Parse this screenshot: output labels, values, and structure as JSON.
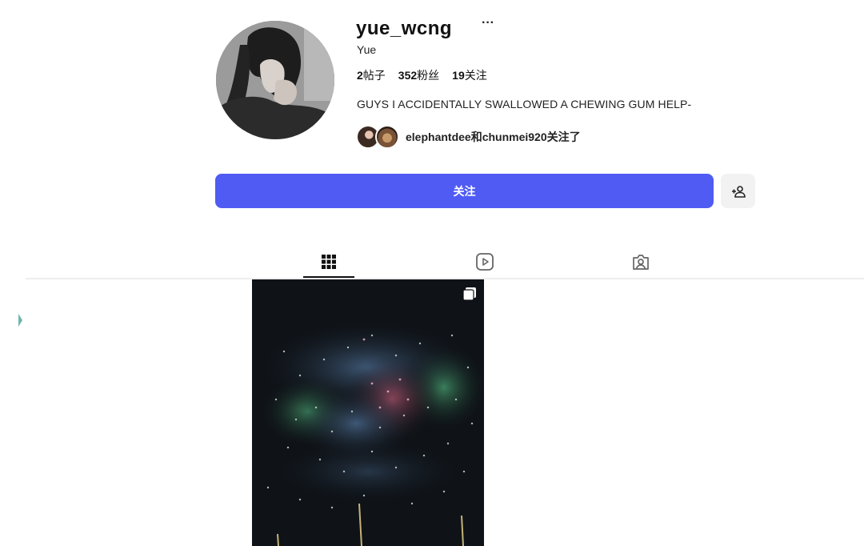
{
  "profile": {
    "username": "yue_wcng",
    "display_name": "Yue",
    "stats": [
      {
        "count": "2",
        "label": "帖子"
      },
      {
        "count": "352",
        "label": "粉丝"
      },
      {
        "count": "19",
        "label": "关注"
      }
    ],
    "bio": "GUYS I ACCIDENTALLY SWALLOWED A CHEWING GUM HELP-",
    "followed_by_text": "elephantdee和chunmei920关注了",
    "more_glyph": "···"
  },
  "actions": {
    "follow_label": "关注"
  },
  "tabs": [
    {
      "name": "posts",
      "icon": "grid-icon",
      "active": true
    },
    {
      "name": "reels",
      "icon": "reels-play-icon",
      "active": false
    },
    {
      "name": "tagged",
      "icon": "tagged-person-icon",
      "active": false
    }
  ],
  "posts": [
    {
      "type": "multi-image",
      "icon": "carousel-icon"
    }
  ],
  "colors": {
    "accent": "#4f5bf3",
    "background": "#ffffff",
    "text": "#111111"
  }
}
